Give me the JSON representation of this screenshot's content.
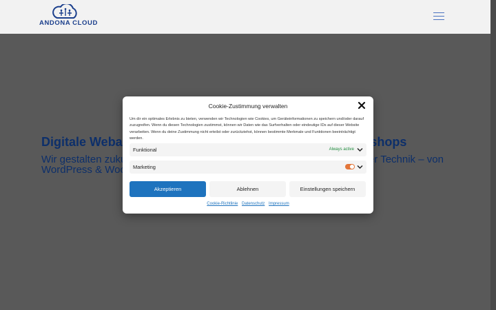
{
  "header": {
    "logo_text": "ANDONA CLOUD",
    "menu_icon": "hamburger-icon"
  },
  "hero": {
    "title": "Digitale Webagentur für moderne Webseiten und Onlineshops",
    "subtitle": "Wir gestalten zukunftssichere Webseiten und Onlineshops mit innovativer Technik – von WordPress & WooCommerce bis individuell"
  },
  "cookie_modal": {
    "title": "Cookie-Zustimmung verwalten",
    "close_icon": "close-icon",
    "description": "Um dir ein optimales Erlebnis zu bieten, verwenden wir Technologien wie Cookies, um Geräteinformationen zu speichern und/oder darauf zuzugreifen. Wenn du diesen Technologien zustimmst, können wir Daten wie das Surfverhalten oder eindeutige IDs auf dieser Website verarbeiten. Wenn du deine Zustimmung nicht erteilst oder zurückziehst, können bestimmte Merkmale und Funktionen beeinträchtigt werden.",
    "categories": [
      {
        "label": "Funktional",
        "status": "Always active"
      },
      {
        "label": "Marketing",
        "toggle": "off"
      }
    ],
    "buttons": {
      "accept": "Akzeptieren",
      "deny": "Ablehnen",
      "save": "Einstellungen speichern"
    },
    "links": {
      "cookie_policy": "Cookie-Richtlinie",
      "privacy": "Datenschutz",
      "imprint": "Impressum"
    }
  },
  "colors": {
    "accent": "#1e73be",
    "brand": "#1b3f8c",
    "active_status": "#1e8a3c",
    "toggle": "#e3763a"
  }
}
